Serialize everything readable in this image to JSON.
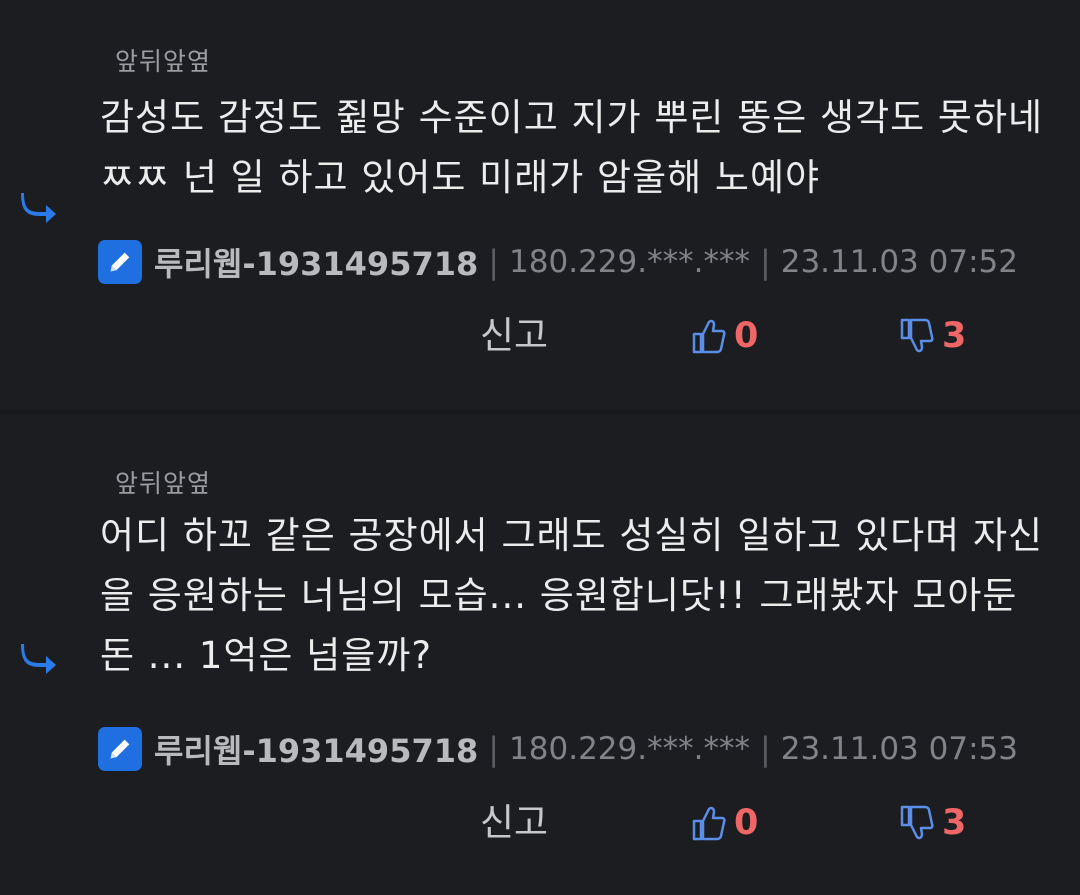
{
  "comments": [
    {
      "label": "앞뒤앞옆",
      "text": "감성도 감정도 쥝망 수준이고 지가 뿌린 똥은 생각도 못하네 ㅉㅉ 넌 일 하고 있어도 미래가 암울해 노예야",
      "author": "루리웹-1931495718",
      "ip": "180.229.***.***",
      "time": "23.11.03 07:52",
      "report_label": "신고",
      "upvotes": "0",
      "downvotes": "3"
    },
    {
      "label": "앞뒤앞옆",
      "text": "어디 하꼬 같은 공장에서 그래도 성실히 일하고 있다며 자신을 응원하는 너님의 모습... 응원합니닷!! 그래봤자 모아둔 돈 ... 1억은 넘을까?",
      "author": "루리웹-1931495718",
      "ip": "180.229.***.***",
      "time": "23.11.03 07:53",
      "report_label": "신고",
      "upvotes": "0",
      "downvotes": "3"
    }
  ],
  "colors": {
    "background": "#1c1d21",
    "accent_blue": "#1f6fe0",
    "vote_count": "#ee6666",
    "thumb_icon": "#5b8ee6"
  },
  "icons": [
    "reply-arrow-icon",
    "pencil-icon",
    "thumbs-up-icon",
    "thumbs-down-icon"
  ]
}
